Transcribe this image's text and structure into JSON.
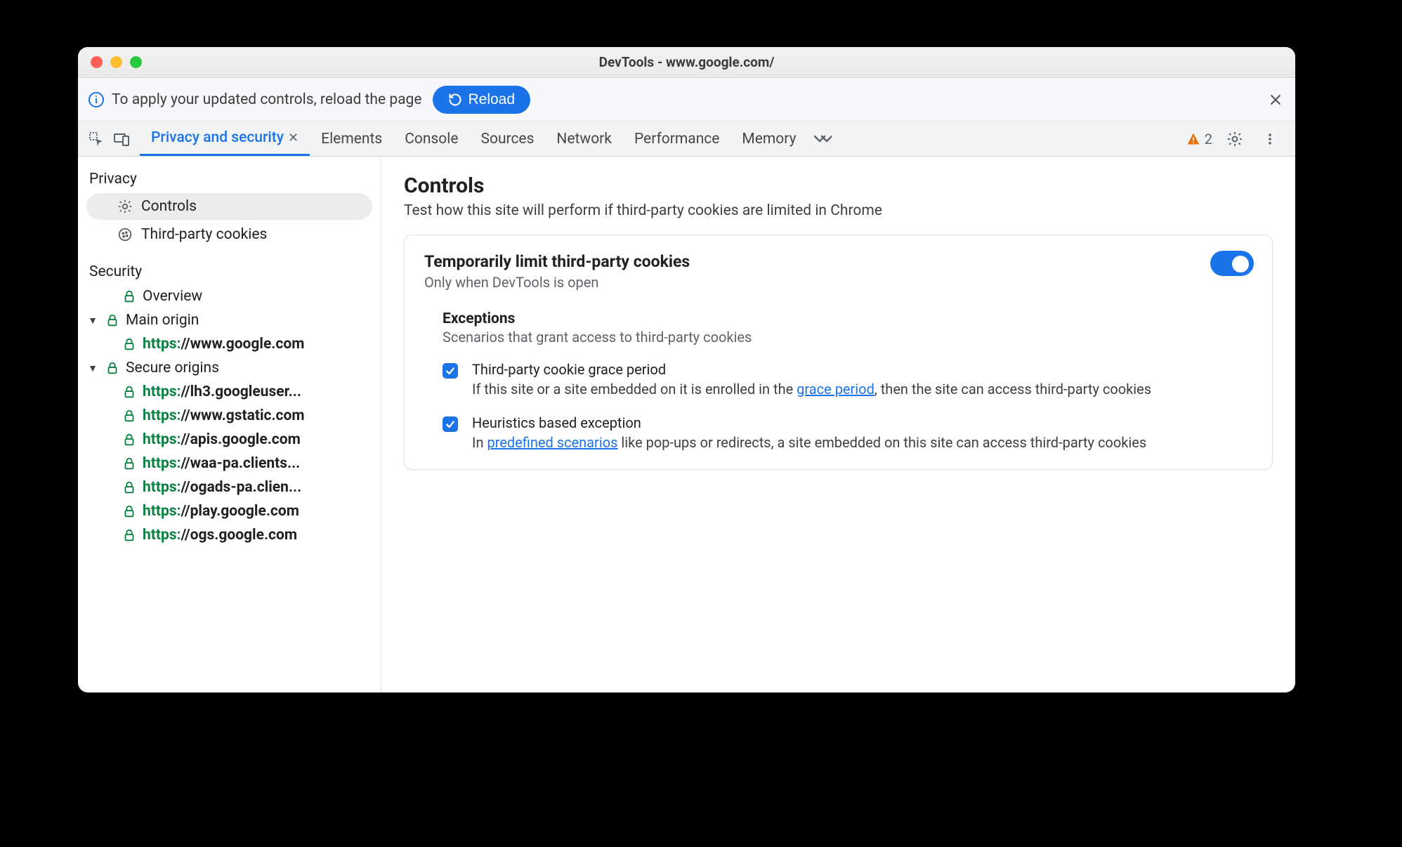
{
  "window": {
    "title": "DevTools - www.google.com/"
  },
  "infobar": {
    "text": "To apply your updated controls, reload the page",
    "reload_label": "Reload"
  },
  "tabs": {
    "active": "Privacy and security",
    "items": [
      "Elements",
      "Console",
      "Sources",
      "Network",
      "Performance",
      "Memory"
    ],
    "warning_count": "2"
  },
  "sidebar": {
    "privacy_label": "Privacy",
    "privacy_items": [
      {
        "label": "Controls"
      },
      {
        "label": "Third-party cookies"
      }
    ],
    "security_label": "Security",
    "overview_label": "Overview",
    "main_origin_label": "Main origin",
    "main_origin_url": {
      "proto": "https:",
      "rest": "//www.google.com"
    },
    "secure_origins_label": "Secure origins",
    "secure_origins": [
      {
        "proto": "https:",
        "rest": "//lh3.googleuser..."
      },
      {
        "proto": "https:",
        "rest": "//www.gstatic.com"
      },
      {
        "proto": "https:",
        "rest": "//apis.google.com"
      },
      {
        "proto": "https:",
        "rest": "//waa-pa.clients..."
      },
      {
        "proto": "https:",
        "rest": "//ogads-pa.clien..."
      },
      {
        "proto": "https:",
        "rest": "//play.google.com"
      },
      {
        "proto": "https:",
        "rest": "//ogs.google.com"
      }
    ]
  },
  "main": {
    "heading": "Controls",
    "subheading": "Test how this site will perform if third-party cookies are limited in Chrome",
    "card": {
      "title": "Temporarily limit third-party cookies",
      "subtitle": "Only when DevTools is open",
      "exceptions_title": "Exceptions",
      "exceptions_sub": "Scenarios that grant access to third-party cookies",
      "items": [
        {
          "title": "Third-party cookie grace period",
          "desc_before": "If this site or a site embedded on it is enrolled in the ",
          "link": "grace period",
          "desc_after": ", then the site can access third-party cookies"
        },
        {
          "title": "Heuristics based exception",
          "desc_before": "In ",
          "link": "predefined scenarios",
          "desc_after": " like pop-ups or redirects, a site embedded on this site can access third-party cookies"
        }
      ]
    }
  }
}
